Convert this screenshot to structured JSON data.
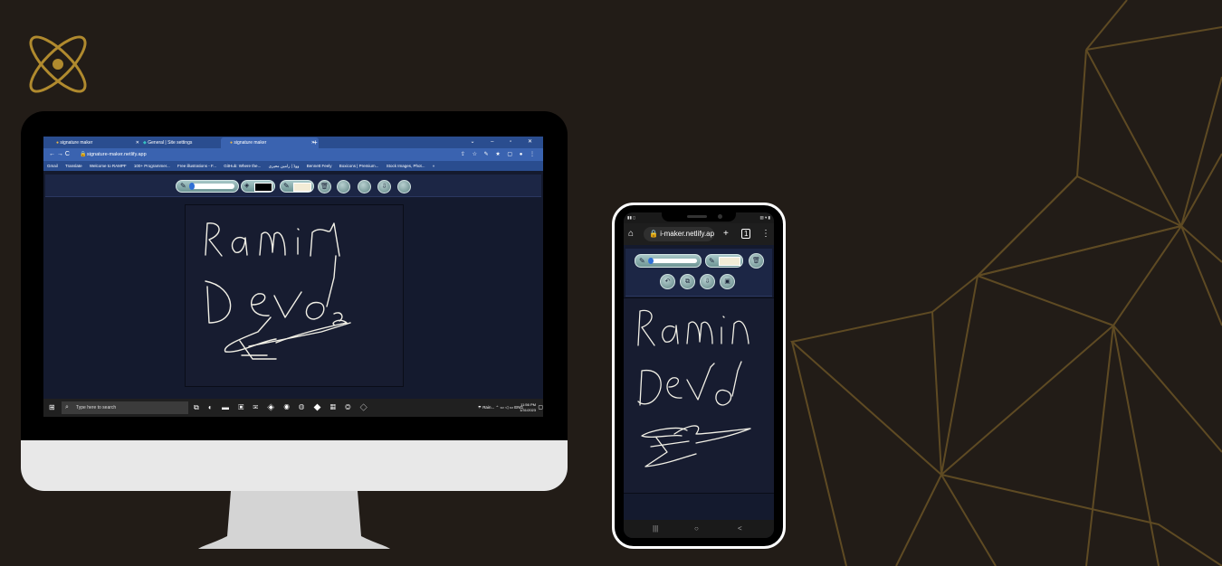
{
  "colors": {
    "background": "#221c17",
    "gold": "#b08a2e",
    "gold_line": "#5e4a23",
    "canvas_bg": "#171c30",
    "ink": "#f2f0e6"
  },
  "logo": {
    "icon": "atom-logo-icon"
  },
  "desktop": {
    "tabs": [
      {
        "label": "signature maker",
        "icon": "site-favicon-icon"
      },
      {
        "label": "General | Site settings",
        "icon": "netlify-icon"
      },
      {
        "label": "signature maker",
        "icon": "site-favicon-icon"
      }
    ],
    "new_tab": "+",
    "window_controls": "⌄ – ▫ ✕",
    "nav": "← → C",
    "url": "signature-maker.netlify.app",
    "bookmarks": [
      "Gmail",
      "Translate",
      "Welcome to RAMPF",
      "100+ Programmer...",
      "Free illustrations - F...",
      "GitHub: Where the...",
      "ووڈ | رامین معیری",
      "Bennett Feely",
      "Boxicons | Premium...",
      "Stock Images, Phot..."
    ],
    "bookmarks_more": "»",
    "search_placeholder": "Type here to search",
    "tray_weather": "Rain...",
    "tray_lang": "ENG",
    "clock_time": "11:56 PM",
    "clock_date": "1/31/2023"
  },
  "phone": {
    "url": "i-maker.netlify.app",
    "plus": "+",
    "tabs_count": "1",
    "menu": "⋮",
    "nav_items": [
      "|||",
      "○",
      "<"
    ]
  },
  "signature_text": "Ramin Devo"
}
